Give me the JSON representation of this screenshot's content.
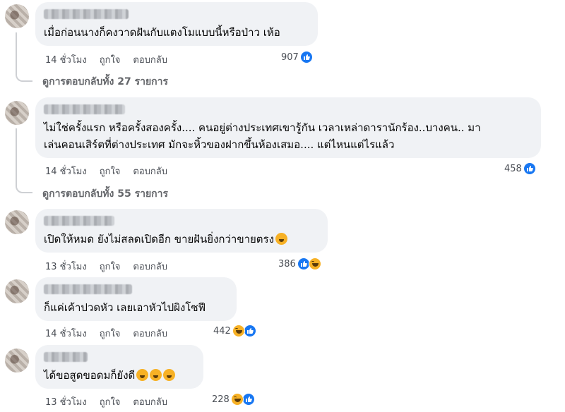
{
  "comments": [
    {
      "text": "เมื่อก่อนนางก็คงวาดฝันกับแตงโมแบบนี้หรือป่าว เห้อ",
      "time": "14 ชั่วโมง",
      "like": "ถูกใจ",
      "reply": "ตอบกลับ",
      "reaction_count": "907",
      "reactions": [
        "like-icon"
      ],
      "view_replies": "ดูการตอบกลับทั้ง 27 รายการ"
    },
    {
      "text_lines": [
        "ไม่ใช่ครั้งแรก หรือครั้งสองครั้ง.... คนอยู่ต่างประเทศเขารู้กัน เวลาเหล่าดารานักร้อง..บางคน.. มา",
        "เล่นคอนเสิร์ตที่ต่างประเทศ มักจะหิ้วของฝากขึ้นห้องเสมอ.... แต่ไหนแต่ไรแล้ว"
      ],
      "time": "14 ชั่วโมง",
      "like": "ถูกใจ",
      "reply": "ตอบกลับ",
      "reaction_count": "458",
      "reactions": [
        "like-icon"
      ],
      "view_replies": "ดูการตอบกลับทั้ง 55 รายการ"
    },
    {
      "text": "เปิดให้หมด ยังไม่สลดเปิดอีก ขายฝันยิ่งกว่าขายตรง",
      "time": "13 ชั่วโมง",
      "like": "ถูกใจ",
      "reply": "ตอบกลับ",
      "reaction_count": "386",
      "reactions": [
        "like-icon",
        "haha-icon"
      ]
    },
    {
      "text": "ก็แค่เค้าปวดหัว เลยเอาหัวไปผิงโซฟี",
      "time": "14 ชั่วโมง",
      "like": "ถูกใจ",
      "reply": "ตอบกลับ",
      "reaction_count": "442",
      "reactions": [
        "haha-icon",
        "like-icon"
      ]
    },
    {
      "text": "ได้ขอสูดขอดมก็ยังดี",
      "time": "13 ชั่วโมง",
      "like": "ถูกใจ",
      "reply": "ตอบกลับ",
      "reaction_count": "228",
      "reactions": [
        "haha-icon",
        "like-icon"
      ]
    }
  ],
  "colors": {
    "bubble": "#f0f2f5",
    "like": "#1877f2",
    "haha": "#f7b125",
    "meta": "#65676b"
  }
}
